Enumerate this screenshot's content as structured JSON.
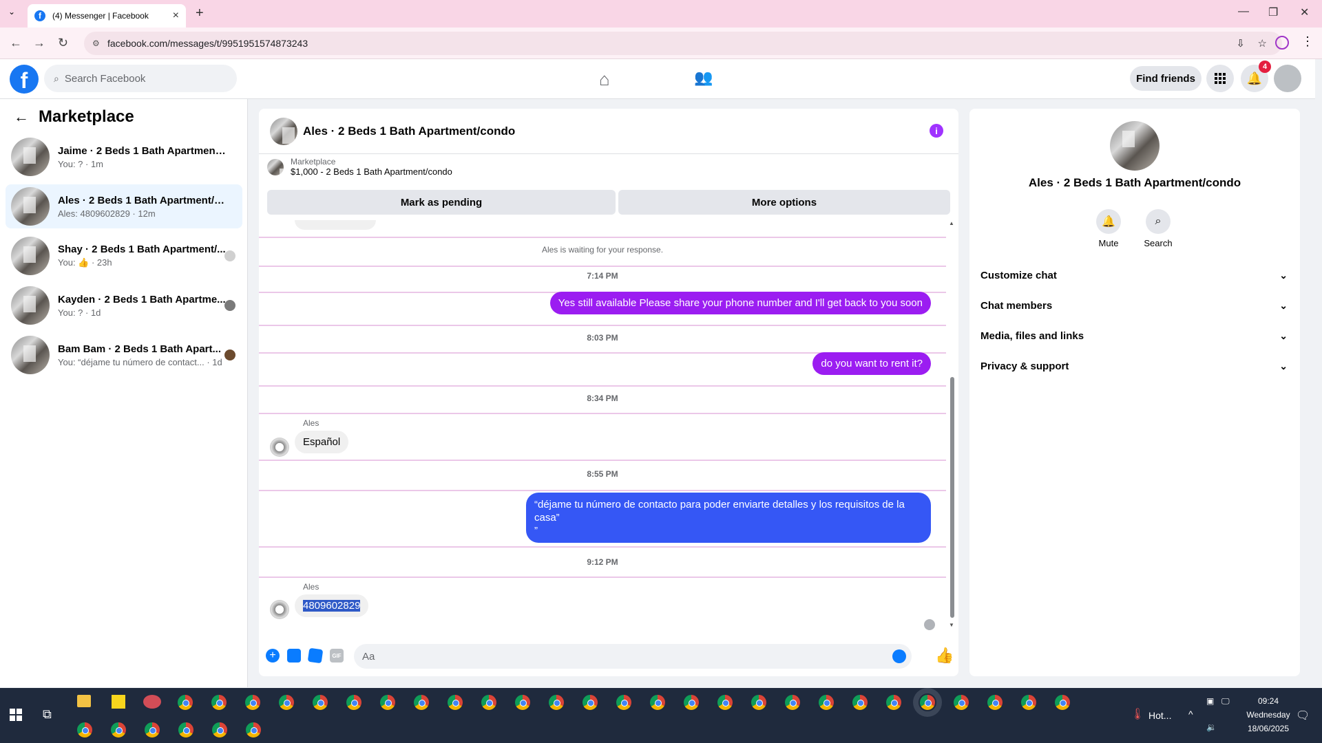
{
  "browser": {
    "tab_title": "(4) Messenger | Facebook",
    "url": "facebook.com/messages/t/9951951574873243"
  },
  "fb": {
    "search_placeholder": "Search Facebook",
    "find_friends": "Find friends",
    "notification_count": "4"
  },
  "sidebar": {
    "title": "Marketplace",
    "conversations": [
      {
        "title": "Jaime · 2 Beds 1 Bath Apartment/c...",
        "sub": "You: ? · 1m"
      },
      {
        "title": "Ales · 2 Beds 1 Bath Apartment/co...",
        "sub": "Ales: 4809602829 · 12m"
      },
      {
        "title": "Shay · 2 Beds 1 Bath Apartment/...",
        "sub": "You: 👍 · 23h"
      },
      {
        "title": "Kayden · 2 Beds 1 Bath Apartme...",
        "sub": "You: ? · 1d"
      },
      {
        "title": "Bam Bam · 2 Beds 1 Bath Apart...",
        "sub": "You: “déjame tu número de contact... · 1d"
      }
    ]
  },
  "chat": {
    "title": "Ales · 2 Beds 1 Bath Apartment/condo",
    "marketplace_label": "Marketplace",
    "listing": "$1,000 - 2 Beds 1 Bath Apartment/condo",
    "mark_pending": "Mark as pending",
    "more_options": "More options",
    "waiting": "Ales is waiting for your response.",
    "messages": {
      "t1": "7:14 PM",
      "m1": "Yes still available Please share your phone number and I'll get back to you soon",
      "t2": "8:03 PM",
      "m2": "do you want to rent it?",
      "t3": "8:34 PM",
      "sender1": "Ales",
      "m3": "Español",
      "t4": "8:55 PM",
      "m4": "“déjame tu número de contacto para poder enviarte detalles y los requisitos de la casa”\n”",
      "t5": "9:12 PM",
      "sender2": "Ales",
      "m5": "4809602829"
    },
    "composer_placeholder": "Aa"
  },
  "details": {
    "name": "Ales · 2 Beds 1 Bath Apartment/condo",
    "mute": "Mute",
    "search": "Search",
    "sections": [
      "Customize chat",
      "Chat members",
      "Media, files and links",
      "Privacy & support"
    ]
  },
  "taskbar": {
    "weather": "Hot...",
    "time": "09:24",
    "day": "Wednesday",
    "date": "18/06/2025"
  }
}
